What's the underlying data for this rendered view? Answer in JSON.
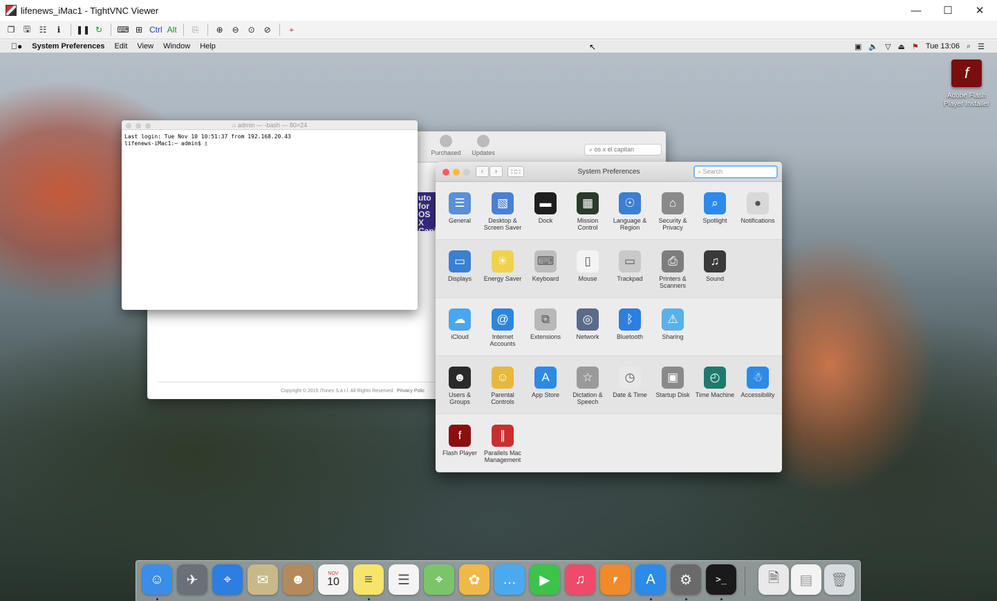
{
  "vnc": {
    "title": "lifenews_iMac1 - TightVNC Viewer",
    "toolbar_ctrl": "Ctrl",
    "toolbar_alt": "Alt"
  },
  "menubar": {
    "app": "System Preferences",
    "items": [
      "Edit",
      "View",
      "Window",
      "Help"
    ],
    "clock": "Tue 13:06"
  },
  "desktop": {
    "flash_installer_label": "Adobe Flash Player Installer"
  },
  "terminal": {
    "title": "admin — -bash — 80×24",
    "line1": "Last login: Tue Nov 10 10:51:37 from 192.168.20.43",
    "line2": "lifenews-iMac1:~ admin$ "
  },
  "appstore": {
    "tab_purchased": "Purchased",
    "tab_updates": "Updates",
    "search_value": "os x el capitan",
    "copyright": "Copyright © 2015 iTunes S.à r.l. All Rights Reserved.",
    "privacy": "Privacy Polic",
    "banner": "uto for OS X Capita"
  },
  "sysprefs": {
    "title": "System Preferences",
    "search_placeholder": "Search",
    "rows": [
      [
        {
          "label": "General",
          "icon": "general-icon",
          "color": "#5b8fd6"
        },
        {
          "label": "Desktop & Screen Saver",
          "icon": "desktop-screensaver-icon",
          "color": "#4a7fd4"
        },
        {
          "label": "Dock",
          "icon": "dock-icon",
          "color": "#1f1f1f"
        },
        {
          "label": "Mission Control",
          "icon": "mission-control-icon",
          "color": "#2b3b2b"
        },
        {
          "label": "Language & Region",
          "icon": "language-region-icon",
          "color": "#3c7fd0"
        },
        {
          "label": "Security & Privacy",
          "icon": "security-privacy-icon",
          "color": "#8a8a8a"
        },
        {
          "label": "Spotlight",
          "icon": "spotlight-icon",
          "color": "#2d8ae8"
        },
        {
          "label": "Notifications",
          "icon": "notifications-icon",
          "color": "#d8d8d8"
        }
      ],
      [
        {
          "label": "Displays",
          "icon": "displays-icon",
          "color": "#3b7fd0"
        },
        {
          "label": "Energy Saver",
          "icon": "energy-saver-icon",
          "color": "#f2d24a"
        },
        {
          "label": "Keyboard",
          "icon": "keyboard-icon",
          "color": "#bdbdbd"
        },
        {
          "label": "Mouse",
          "icon": "mouse-icon",
          "color": "#f3f3f3"
        },
        {
          "label": "Trackpad",
          "icon": "trackpad-icon",
          "color": "#c9c9c9"
        },
        {
          "label": "Printers & Scanners",
          "icon": "printers-scanners-icon",
          "color": "#7d7d7d"
        },
        {
          "label": "Sound",
          "icon": "sound-icon",
          "color": "#3a3a3a"
        }
      ],
      [
        {
          "label": "iCloud",
          "icon": "icloud-icon",
          "color": "#4aa6f0"
        },
        {
          "label": "Internet Accounts",
          "icon": "internet-accounts-icon",
          "color": "#2c86e0"
        },
        {
          "label": "Extensions",
          "icon": "extensions-icon",
          "color": "#b8b8b8"
        },
        {
          "label": "Network",
          "icon": "network-icon",
          "color": "#5a6a8a"
        },
        {
          "label": "Bluetooth",
          "icon": "bluetooth-icon",
          "color": "#2c7fe0"
        },
        {
          "label": "Sharing",
          "icon": "sharing-icon",
          "color": "#5ab0e8"
        }
      ],
      [
        {
          "label": "Users & Groups",
          "icon": "users-groups-icon",
          "color": "#2a2a2a"
        },
        {
          "label": "Parental Controls",
          "icon": "parental-controls-icon",
          "color": "#e8b83a"
        },
        {
          "label": "App Store",
          "icon": "app-store-icon",
          "color": "#2c8ae8"
        },
        {
          "label": "Dictation & Speech",
          "icon": "dictation-speech-icon",
          "color": "#9a9a9a"
        },
        {
          "label": "Date & Time",
          "icon": "date-time-icon",
          "color": "#e8e8e8"
        },
        {
          "label": "Startup Disk",
          "icon": "startup-disk-icon",
          "color": "#8a8a8a"
        },
        {
          "label": "Time Machine",
          "icon": "time-machine-icon",
          "color": "#1f7a6e"
        },
        {
          "label": "Accessibility",
          "icon": "accessibility-icon",
          "color": "#2c8ae8"
        }
      ],
      [
        {
          "label": "Flash Player",
          "icon": "flash-player-icon",
          "color": "#8a1010"
        },
        {
          "label": "Parallels Mac Management",
          "icon": "parallels-icon",
          "color": "#c83030"
        }
      ]
    ]
  },
  "dock": [
    {
      "name": "finder",
      "color": "#3a8ee8",
      "running": true
    },
    {
      "name": "launchpad",
      "color": "#6a6f78",
      "running": false
    },
    {
      "name": "safari",
      "color": "#2a7fe0",
      "running": false
    },
    {
      "name": "mail",
      "color": "#c9b98a",
      "running": false
    },
    {
      "name": "contacts",
      "color": "#b48a5a",
      "running": false
    },
    {
      "name": "calendar",
      "color": "#f4f4f4",
      "running": false
    },
    {
      "name": "notes",
      "color": "#f7e56a",
      "running": true
    },
    {
      "name": "reminders",
      "color": "#f4f4f4",
      "running": false
    },
    {
      "name": "maps",
      "color": "#7cc46a",
      "running": false
    },
    {
      "name": "photos",
      "color": "#f0b84a",
      "running": false
    },
    {
      "name": "messages",
      "color": "#4aaaf0",
      "running": false
    },
    {
      "name": "facetime",
      "color": "#3cc34a",
      "running": false
    },
    {
      "name": "itunes",
      "color": "#f04a6a",
      "running": false
    },
    {
      "name": "ibooks",
      "color": "#f08a2a",
      "running": false
    },
    {
      "name": "app-store",
      "color": "#2c8ae8",
      "running": true
    },
    {
      "name": "system-preferences",
      "color": "#6a6a6a",
      "running": true
    },
    {
      "name": "terminal",
      "color": "#1a1a1a",
      "running": true
    }
  ],
  "calendar_month": "NOV",
  "calendar_day": "10"
}
